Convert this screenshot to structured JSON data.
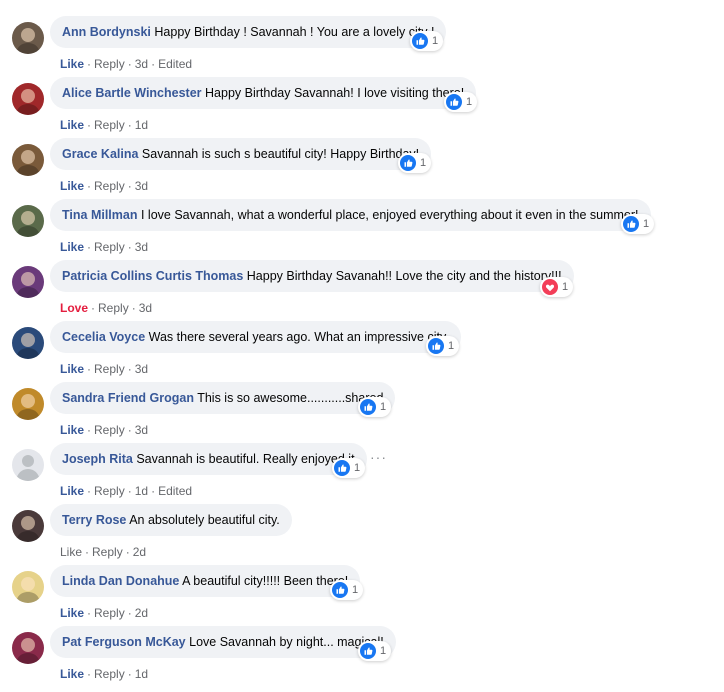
{
  "comments": [
    {
      "author": "Ann Bordynski",
      "text": "Happy Birthday ! Savannah ! You are a lovely city !",
      "like": "Like",
      "reply": "Reply",
      "time": "3d",
      "edited": "Edited",
      "reaction": "like",
      "count": "1",
      "avatar_color": "#6b5a4a"
    },
    {
      "author": "Alice Bartle Winchester",
      "text": "Happy Birthday Savannah! I love visiting there!",
      "like": "Like",
      "reply": "Reply",
      "time": "1d",
      "reaction": "like",
      "count": "1",
      "avatar_color": "#a0282a"
    },
    {
      "author": "Grace Kalina",
      "text": "Savannah is such s beautiful city! Happy Birthday!",
      "like": "Like",
      "reply": "Reply",
      "time": "3d",
      "reaction": "like",
      "count": "1",
      "avatar_color": "#7a5a3a"
    },
    {
      "author": "Tina Millman",
      "text": "I love Savannah, what a wonderful place, enjoyed everything about it even in the summer!",
      "like": "Like",
      "reply": "Reply",
      "time": "3d",
      "reaction": "like",
      "count": "1",
      "avatar_color": "#5a6a4a"
    },
    {
      "author": "Patricia Collins Curtis Thomas",
      "text": "Happy Birthday Savanah!! Love the city and the history!!!",
      "like": "Love",
      "reply": "Reply",
      "time": "3d",
      "reaction": "love",
      "count": "1",
      "avatar_color": "#6a3a7a"
    },
    {
      "author": "Cecelia Voyce",
      "text": "Was there several years ago. What an impressive city.",
      "like": "Like",
      "reply": "Reply",
      "time": "3d",
      "reaction": "like",
      "count": "1",
      "avatar_color": "#2a4a7a"
    },
    {
      "author": "Sandra Friend Grogan",
      "text": "This is so awesome...........shared",
      "like": "Like",
      "reply": "Reply",
      "time": "3d",
      "reaction": "like",
      "count": "1",
      "avatar_color": "#c08a2a"
    },
    {
      "author": "Joseph Rita",
      "text": "Savannah is beautiful. Really enjoyed it",
      "like": "Like",
      "reply": "Reply",
      "time": "1d",
      "edited": "Edited",
      "reaction": "like",
      "count": "1",
      "avatar_color": "#d8dadf",
      "more": "···"
    },
    {
      "author": "Terry Rose",
      "text": "An absolutely beautiful city.",
      "like": "Like",
      "reply": "Reply",
      "time": "2d",
      "like_plain": true,
      "avatar_color": "#4a3a3a"
    },
    {
      "author": "Linda Dan Donahue",
      "text": "A beautiful city!!!!! Been there!",
      "like": "Like",
      "reply": "Reply",
      "time": "2d",
      "reaction": "like",
      "count": "1",
      "avatar_color": "#e6d28a"
    },
    {
      "author": "Pat Ferguson McKay",
      "text": "Love Savannah by night... magical!",
      "like": "Like",
      "reply": "Reply",
      "time": "1d",
      "reaction": "like",
      "count": "1",
      "avatar_color": "#8a2a4a"
    }
  ],
  "colors": {
    "author": "#385898",
    "meta": "#65676b",
    "love": "#e41e3f",
    "like_icon": "#1877f2",
    "bubble": "#f0f2f5"
  }
}
